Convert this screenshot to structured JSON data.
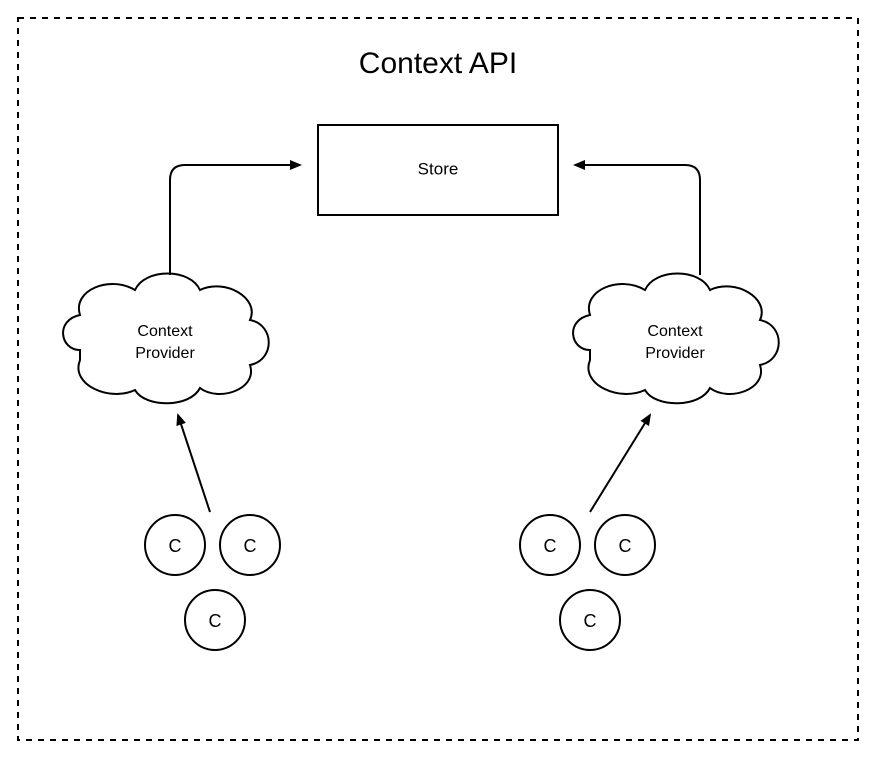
{
  "title": "Context API",
  "store": {
    "label": "Store"
  },
  "providers": {
    "left": {
      "line1": "Context",
      "line2": "Provider"
    },
    "right": {
      "line1": "Context",
      "line2": "Provider"
    }
  },
  "component_label": "C"
}
